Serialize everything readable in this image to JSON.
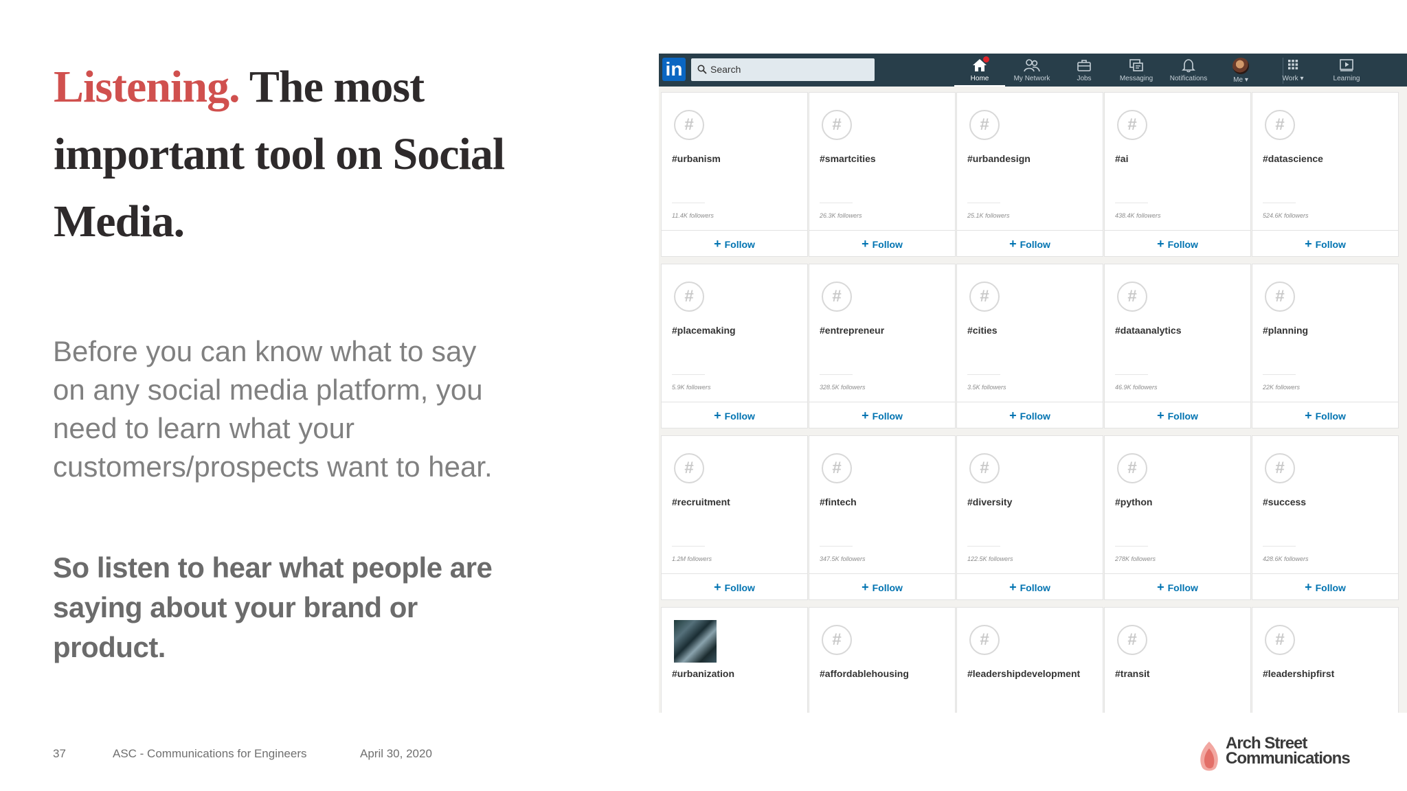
{
  "slide": {
    "title_accent": "Listening.",
    "title_rest": " The most important tool on Social Media.",
    "body_paragraph": "Before you can know what to say on any social media platform, you need to learn what your customers/prospects want to hear.",
    "emphasis_paragraph": "So listen to hear what people are saying about your brand or product.",
    "footer": {
      "page_number": "37",
      "course": "ASC - Communications for Engineers",
      "date": "April 30, 2020"
    },
    "brand": {
      "line1": "Arch Street",
      "line2": "Communications"
    },
    "colors": {
      "accent": "#d0504e",
      "title": "#2e2a2b",
      "body": "#808080"
    }
  },
  "linkedin": {
    "logo": "in",
    "search_placeholder": "Search",
    "nav": [
      {
        "label": "Home",
        "icon": "home-icon",
        "active": true
      },
      {
        "label": "My Network",
        "icon": "network-icon"
      },
      {
        "label": "Jobs",
        "icon": "briefcase-icon"
      },
      {
        "label": "Messaging",
        "icon": "messaging-icon"
      },
      {
        "label": "Notifications",
        "icon": "bell-icon"
      },
      {
        "label": "Me",
        "icon": "avatar"
      },
      {
        "label": "Work",
        "icon": "grid-icon"
      },
      {
        "label": "Learning",
        "icon": "play-icon"
      }
    ],
    "follow_label": "Follow",
    "hashtags": [
      [
        {
          "tag": "#urbanism",
          "followers": "11.4K followers"
        },
        {
          "tag": "#smartcities",
          "followers": "26.3K followers"
        },
        {
          "tag": "#urbandesign",
          "followers": "25.1K followers"
        },
        {
          "tag": "#ai",
          "followers": "438.4K followers"
        },
        {
          "tag": "#datascience",
          "followers": "524.6K followers"
        }
      ],
      [
        {
          "tag": "#placemaking",
          "followers": "5.9K followers"
        },
        {
          "tag": "#entrepreneur",
          "followers": "328.5K followers"
        },
        {
          "tag": "#cities",
          "followers": "3.5K followers"
        },
        {
          "tag": "#dataanalytics",
          "followers": "46.9K followers"
        },
        {
          "tag": "#planning",
          "followers": "22K followers"
        }
      ],
      [
        {
          "tag": "#recruitment",
          "followers": "1.2M followers"
        },
        {
          "tag": "#fintech",
          "followers": "347.5K followers"
        },
        {
          "tag": "#diversity",
          "followers": "122.5K followers"
        },
        {
          "tag": "#python",
          "followers": "278K followers"
        },
        {
          "tag": "#success",
          "followers": "428.6K followers"
        }
      ],
      [
        {
          "tag": "#urbanization",
          "followers": "",
          "thumbnail": true
        },
        {
          "tag": "#affordablehousing",
          "followers": ""
        },
        {
          "tag": "#leadershipdevelopment",
          "followers": ""
        },
        {
          "tag": "#transit",
          "followers": ""
        },
        {
          "tag": "#leadershipfirst",
          "followers": ""
        }
      ]
    ]
  }
}
